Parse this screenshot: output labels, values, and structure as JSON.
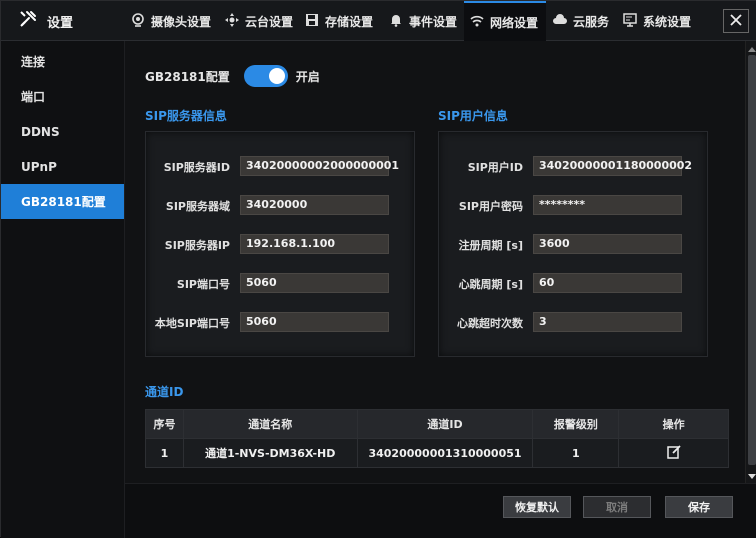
{
  "app": {
    "title": "设置"
  },
  "tabs": [
    {
      "label": "摄像头设置",
      "icon": "camera-icon"
    },
    {
      "label": "云台设置",
      "icon": "ptz-icon"
    },
    {
      "label": "存储设置",
      "icon": "storage-icon"
    },
    {
      "label": "事件设置",
      "icon": "bell-icon"
    },
    {
      "label": "网络设置",
      "icon": "wifi-icon",
      "active": true
    },
    {
      "label": "云服务",
      "icon": "cloud-icon"
    },
    {
      "label": "系统设置",
      "icon": "monitor-icon"
    }
  ],
  "sidebar": {
    "items": [
      {
        "label": "连接"
      },
      {
        "label": "端口"
      },
      {
        "label": "DDNS"
      },
      {
        "label": "UPnP"
      },
      {
        "label": "GB28181配置",
        "active": true
      }
    ]
  },
  "gb": {
    "label": "GB28181配置",
    "state_label": "开启",
    "enabled": true
  },
  "sip_server": {
    "title": "SIP服务器信息",
    "fields": [
      {
        "label": "SIP服务器ID",
        "value": "34020000002000000001"
      },
      {
        "label": "SIP服务器域",
        "value": "34020000"
      },
      {
        "label": "SIP服务器IP",
        "value": "192.168.1.100"
      },
      {
        "label": "SIP端口号",
        "value": "5060"
      },
      {
        "label": "本地SIP端口号",
        "value": "5060"
      }
    ]
  },
  "sip_user": {
    "title": "SIP用户信息",
    "fields": [
      {
        "label": "SIP用户ID",
        "value": "34020000001180000002"
      },
      {
        "label": "SIP用户密码",
        "value": "********"
      },
      {
        "label": "注册周期 [s]",
        "value": "3600"
      },
      {
        "label": "心跳周期 [s]",
        "value": "60"
      },
      {
        "label": "心跳超时次数",
        "value": "3"
      }
    ]
  },
  "channel": {
    "title": "通道ID",
    "headers": [
      "序号",
      "通道名称",
      "通道ID",
      "报警级别",
      "操作"
    ],
    "rows": [
      {
        "index": "1",
        "name": "通道1-NVS-DM36X-HD",
        "id": "34020000001310000051",
        "level": "1"
      }
    ]
  },
  "footer": {
    "restore_label": "恢复默认",
    "cancel_label": "取消",
    "save_label": "保存"
  },
  "colors": {
    "accent": "#2b8ae5",
    "section_title": "#3a97ec"
  }
}
